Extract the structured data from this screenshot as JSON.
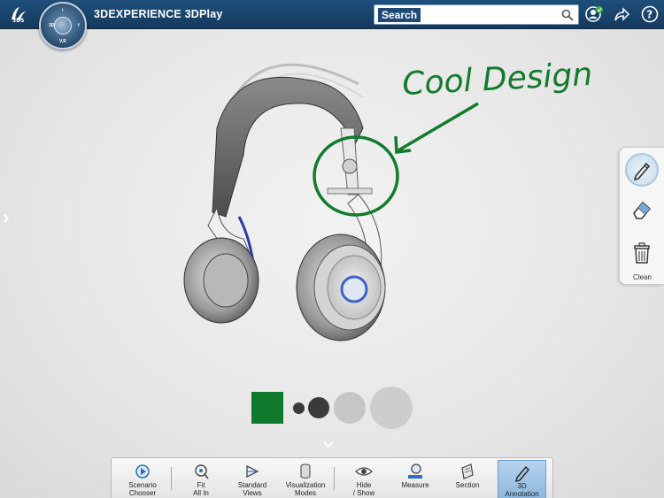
{
  "app": {
    "title": "3DEXPERIENCE 3DPlay"
  },
  "compass": {
    "labels": [
      "3D",
      "V,R",
      "i",
      "f"
    ]
  },
  "search": {
    "label": "Search",
    "placeholder": ""
  },
  "annotation": {
    "text": "Cool Design",
    "color": "#127a2c"
  },
  "right_panel": {
    "tools": [
      {
        "name": "pen",
        "icon": "pencil-icon",
        "active": true
      },
      {
        "name": "eraser",
        "icon": "eraser-icon"
      },
      {
        "name": "clean",
        "icon": "trash-icon",
        "label": "Clean"
      }
    ]
  },
  "palette": {
    "color": "#0f7a2c"
  },
  "toolbar": {
    "items": [
      {
        "label": "Scenario\nChooser",
        "icon": "scenario-icon"
      },
      {
        "label": "Fit\nAll In",
        "icon": "fit-all-icon"
      },
      {
        "label": "Standard\nViews",
        "icon": "standard-views-icon"
      },
      {
        "label": "Visualization\nModes",
        "icon": "visualization-icon"
      },
      {
        "label": "Hide\n/ Show",
        "icon": "eye-icon"
      },
      {
        "label": "Measure",
        "icon": "measure-icon"
      },
      {
        "label": "Section",
        "icon": "section-icon"
      },
      {
        "label": "3D\nAnnotation",
        "icon": "annotation-pencil-icon",
        "active": true
      }
    ]
  },
  "colors": {
    "topbar": "#1a4570",
    "accent": "#4a89c4",
    "annotation_green": "#127a2c"
  }
}
